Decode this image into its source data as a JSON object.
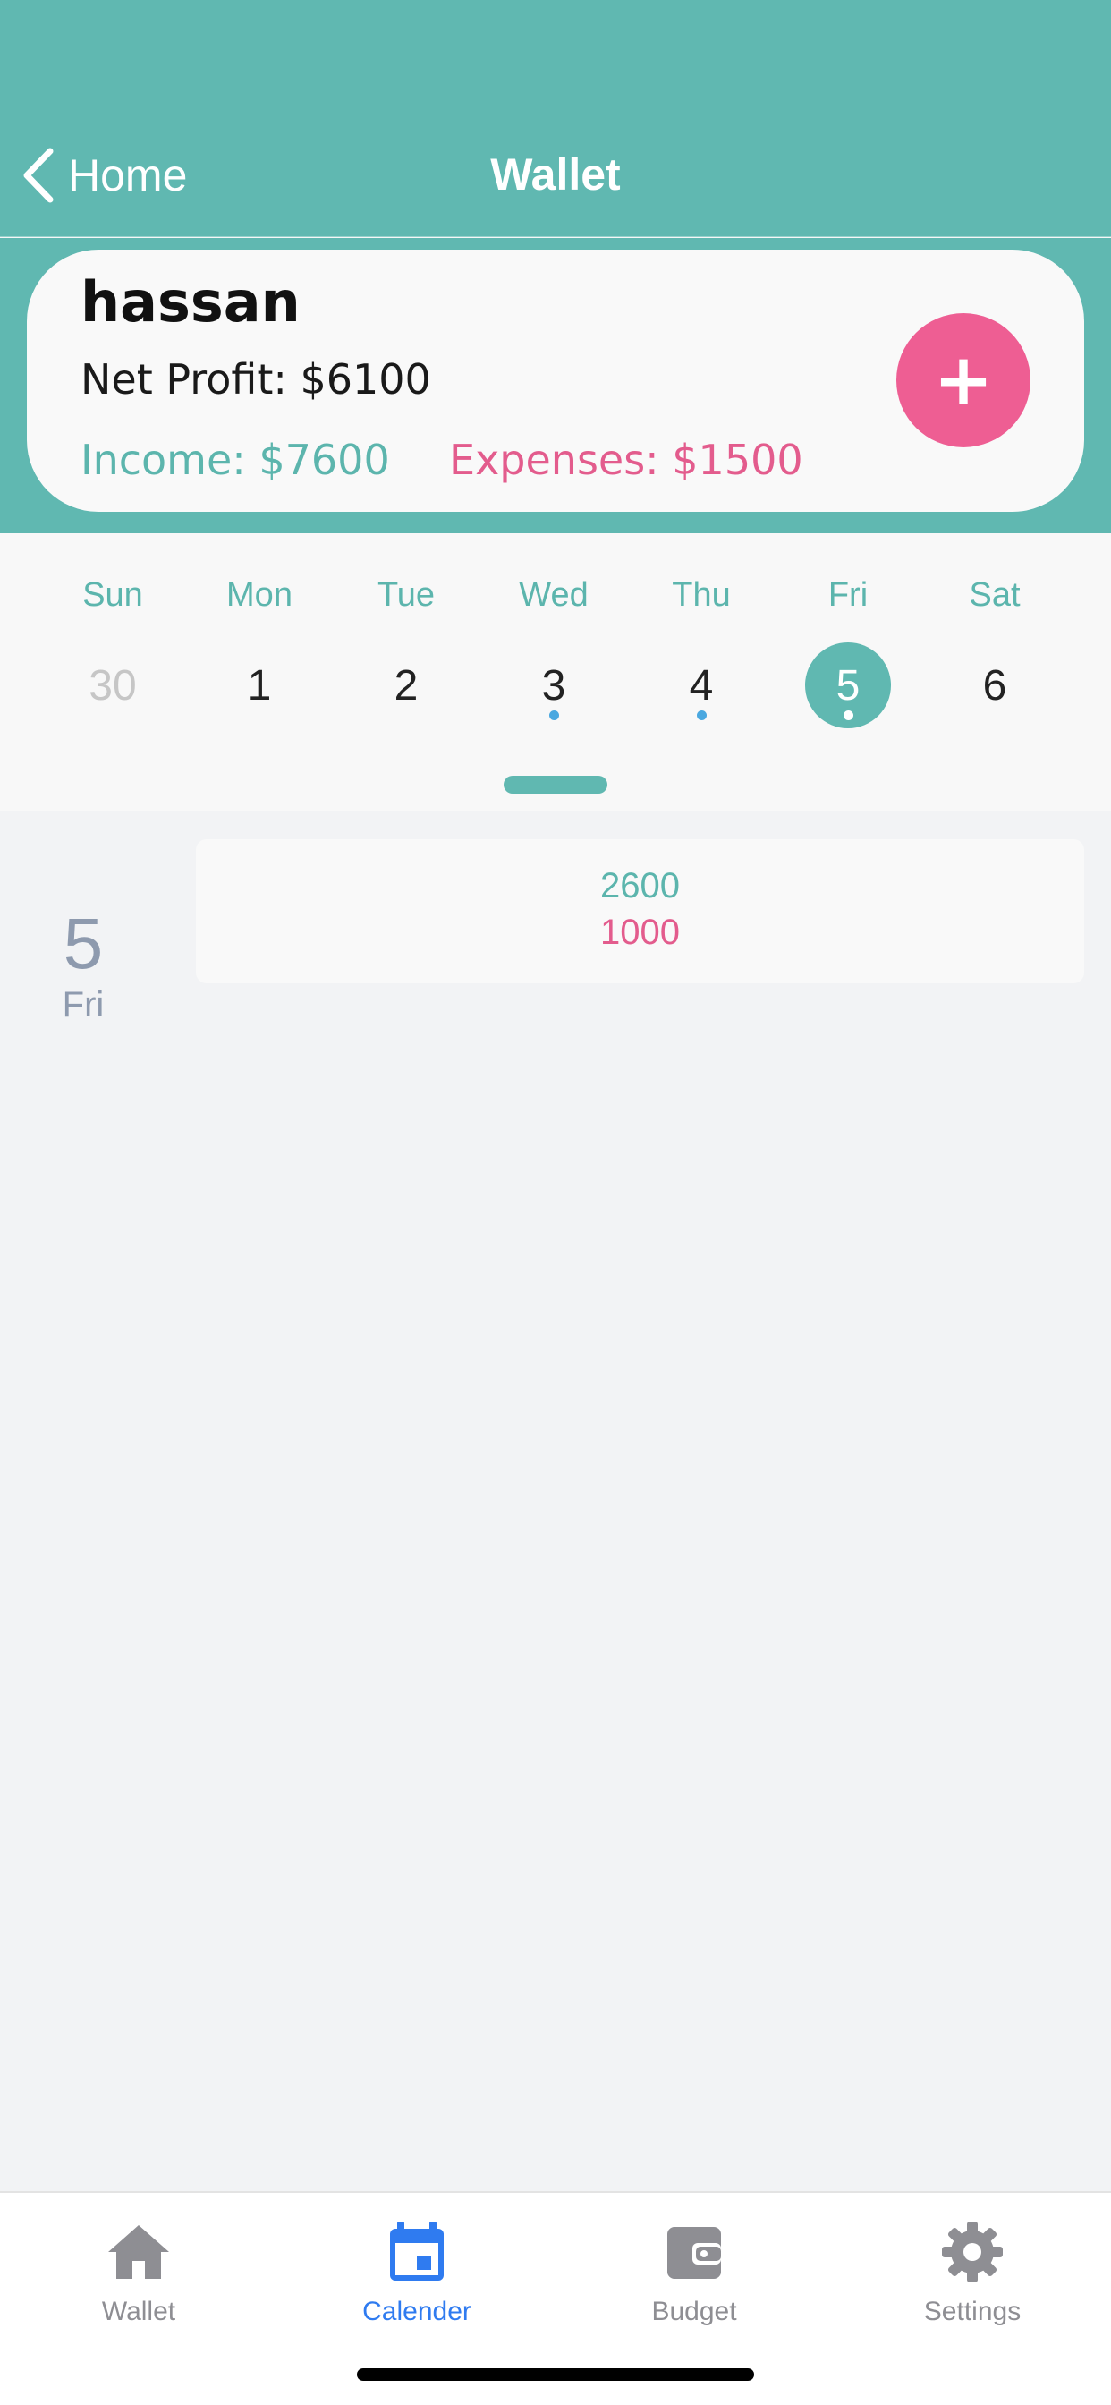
{
  "header": {
    "back_label": "Home",
    "title": "Wallet"
  },
  "card": {
    "name": "hassan",
    "net_profit": "Net Profit: $6100",
    "income": "Income: $7600",
    "expenses": "Expenses: $1500",
    "add_label": "+"
  },
  "week": {
    "days": [
      {
        "dow": "Sun",
        "date": "30",
        "muted": true,
        "dot": false,
        "selected": false
      },
      {
        "dow": "Mon",
        "date": "1",
        "muted": false,
        "dot": false,
        "selected": false
      },
      {
        "dow": "Tue",
        "date": "2",
        "muted": false,
        "dot": false,
        "selected": false
      },
      {
        "dow": "Wed",
        "date": "3",
        "muted": false,
        "dot": true,
        "selected": false
      },
      {
        "dow": "Thu",
        "date": "4",
        "muted": false,
        "dot": true,
        "selected": false
      },
      {
        "dow": "Fri",
        "date": "5",
        "muted": false,
        "dot": true,
        "selected": true
      },
      {
        "dow": "Sat",
        "date": "6",
        "muted": false,
        "dot": false,
        "selected": false
      }
    ]
  },
  "agenda": {
    "date_num": "5",
    "date_dow": "Fri",
    "income_value": "2600",
    "expense_value": "1000"
  },
  "tabbar": {
    "tabs": [
      {
        "label": "Wallet",
        "icon": "home-icon",
        "active": false
      },
      {
        "label": "Calender",
        "icon": "calendar-icon",
        "active": true
      },
      {
        "label": "Budget",
        "icon": "wallet-icon",
        "active": false
      },
      {
        "label": "Settings",
        "icon": "gear-icon",
        "active": false
      }
    ]
  },
  "colors": {
    "teal": "#60b8b1",
    "pink": "#ee5e93",
    "active_tab": "#2f7bf0",
    "inactive_tab": "#8e8e93",
    "event_dot": "#4aa8e0"
  }
}
